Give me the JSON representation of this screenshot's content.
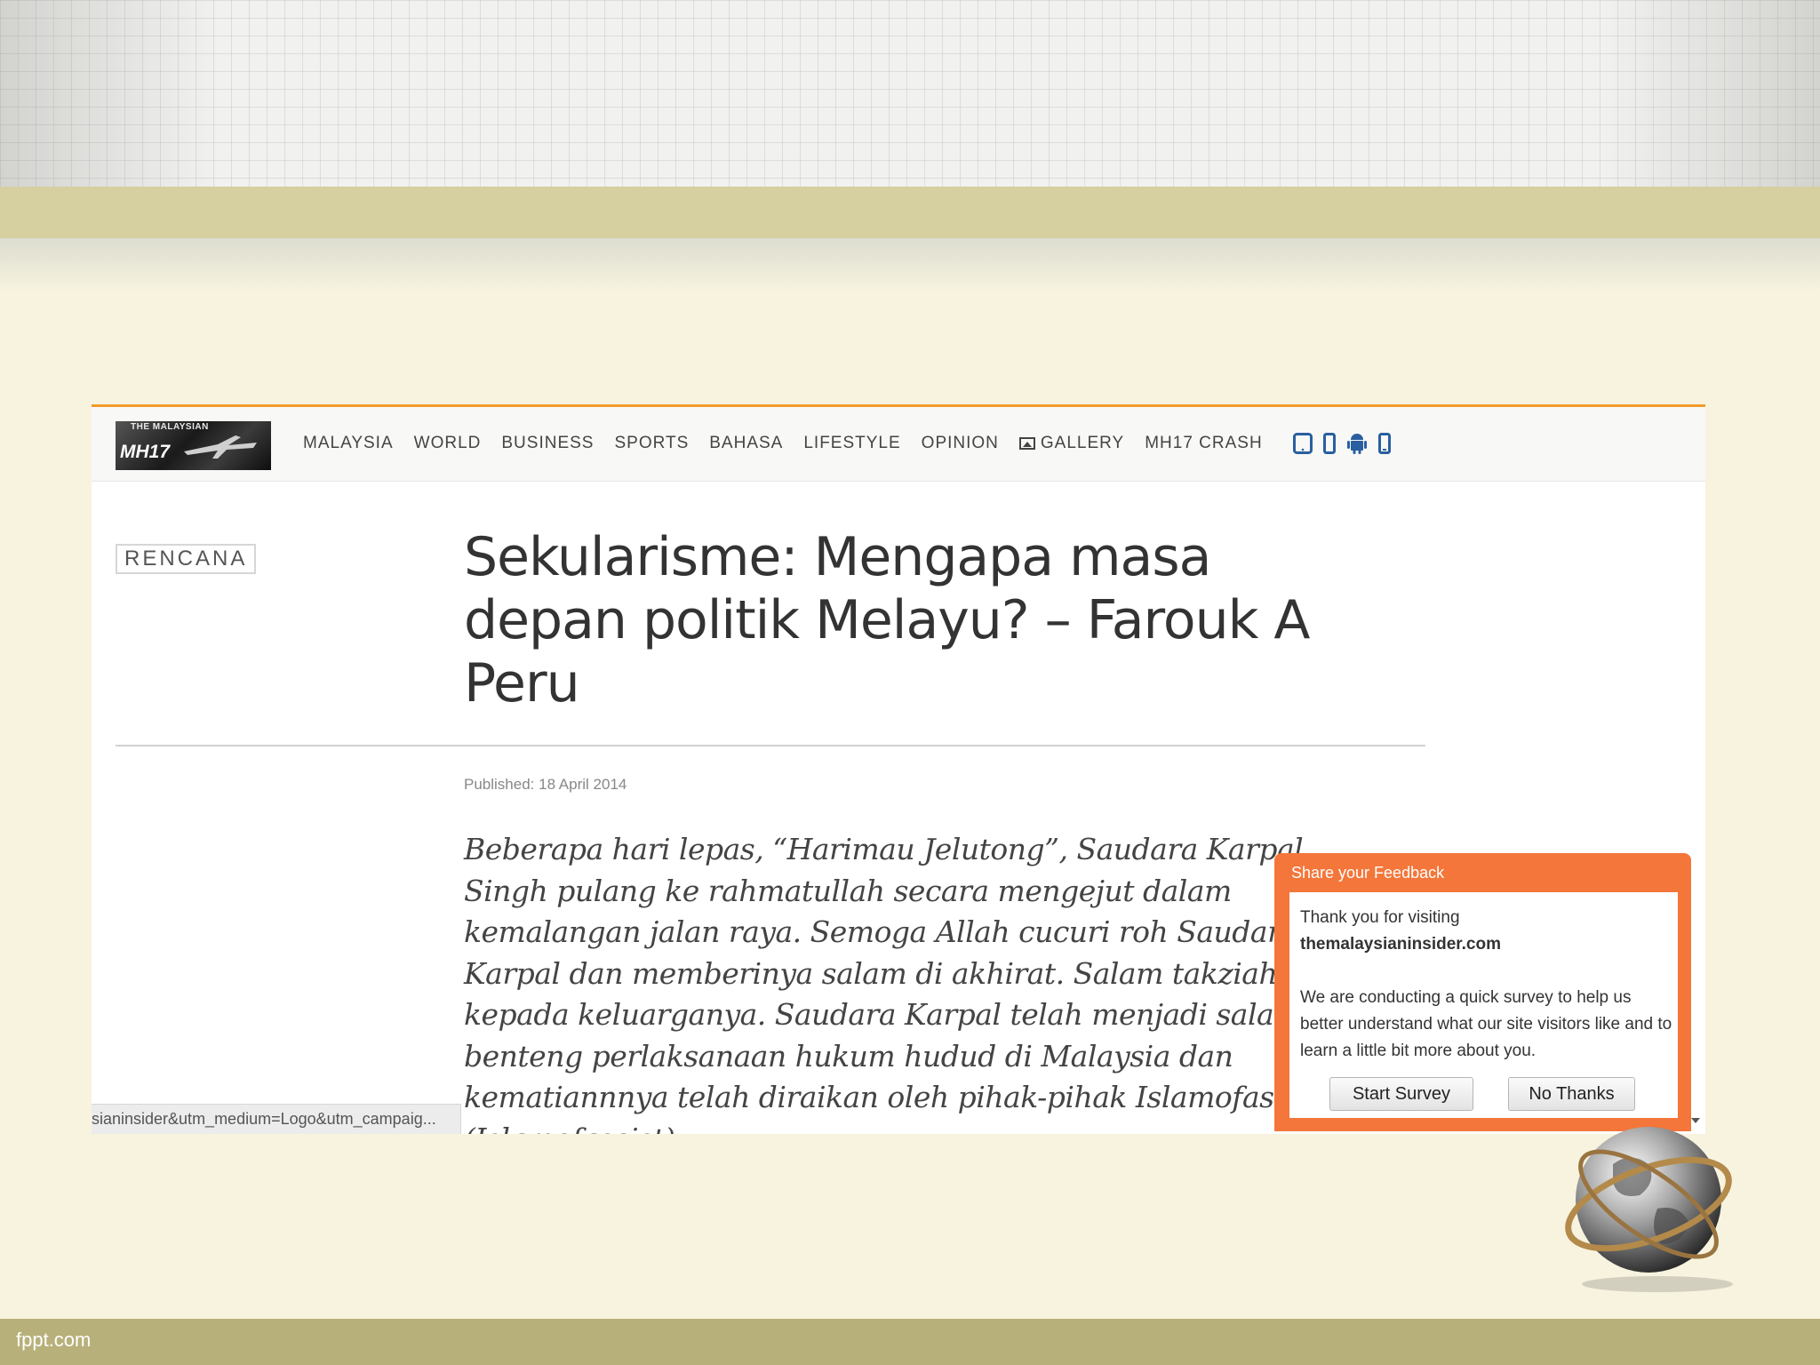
{
  "slide": {
    "footer_text": "fppt.com"
  },
  "site": {
    "logo_top": "THE MALAYSIAN",
    "logo_main": "MH17",
    "nav_items": [
      "MALAYSIA",
      "WORLD",
      "BUSINESS",
      "SPORTS",
      "BAHASA",
      "LIFESTYLE",
      "OPINION",
      "GALLERY",
      "MH17 CRASH"
    ],
    "nav_gallery_icon": "image-icon",
    "device_icons": [
      "tablet-icon",
      "phone-icon",
      "android-icon",
      "mobile-icon"
    ],
    "accent_color": "#f29b2c"
  },
  "article": {
    "category": "RENCANA",
    "title": "Sekularisme: Mengapa masa depan politik Melayu? – Farouk A Peru",
    "published": "Published: 18 April 2014",
    "body": "Beberapa hari lepas,  “Harimau Jelutong”, Saudara Karpal Singh pulang ke rahmatullah secara mengejut dalam kemalangan jalan raya. Semoga Allah cucuri roh Saudara Karpal dan memberinya salam di akhirat. Salam takziah kepada keluarganya. Saudara Karpal telah menjadi salah satu benteng perlaksanaan hukum hudud di Malaysia dan kematiannnya telah diraikan oleh pihak-pihak Islamofasis (Islamofascist)"
  },
  "status_bar": {
    "url": "sianinsider&utm_medium=Logo&utm_campaig..."
  },
  "feedback": {
    "title": "Share your Feedback",
    "line1": "Thank you for visiting",
    "site": "themalaysianinsider.com",
    "paragraph": "We are conducting a quick survey to help us better understand what our site visitors like and to learn a little bit more about you.",
    "start_label": "Start Survey",
    "no_label": "No Thanks",
    "color": "#f4763a"
  }
}
